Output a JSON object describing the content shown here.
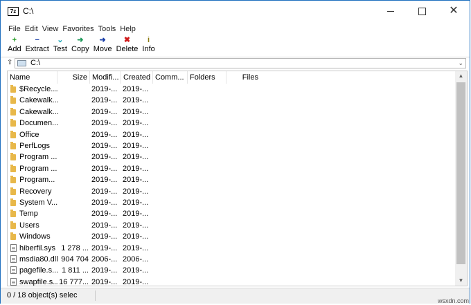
{
  "window": {
    "title": "C:\\",
    "icon": "7z-app-icon"
  },
  "menu": [
    "File",
    "Edit",
    "View",
    "Favorites",
    "Tools",
    "Help"
  ],
  "toolbar": [
    {
      "label": "Add",
      "icon": "+",
      "name": "add",
      "color": "#1e9a1e"
    },
    {
      "label": "Extract",
      "icon": "−",
      "name": "extract",
      "color": "#1a3fa8"
    },
    {
      "label": "Test",
      "icon": "⌄",
      "name": "test",
      "color": "#20a8b8"
    },
    {
      "label": "Copy",
      "icon": "➜",
      "name": "copy",
      "color": "#1e9a5a"
    },
    {
      "label": "Move",
      "icon": "➜",
      "name": "move",
      "color": "#1a3fa8"
    },
    {
      "label": "Delete",
      "icon": "✖",
      "name": "delete",
      "color": "#d01c1c"
    },
    {
      "label": "Info",
      "icon": "i",
      "name": "info",
      "color": "#8a7a10"
    }
  ],
  "address": {
    "path": "C:\\"
  },
  "columns": [
    "Name",
    "Size",
    "Modifi...",
    "Created",
    "Comm...",
    "Folders",
    "Files"
  ],
  "rows": [
    {
      "type": "folder",
      "name": "$Recycle....",
      "size": "",
      "modified": "2019-...",
      "created": "2019-..."
    },
    {
      "type": "folder",
      "name": "Cakewalk...",
      "size": "",
      "modified": "2019-...",
      "created": "2019-..."
    },
    {
      "type": "folder",
      "name": "Cakewalk...",
      "size": "",
      "modified": "2019-...",
      "created": "2019-..."
    },
    {
      "type": "folder",
      "name": "Documen...",
      "size": "",
      "modified": "2019-...",
      "created": "2019-..."
    },
    {
      "type": "folder",
      "name": "Office",
      "size": "",
      "modified": "2019-...",
      "created": "2019-..."
    },
    {
      "type": "folder",
      "name": "PerfLogs",
      "size": "",
      "modified": "2019-...",
      "created": "2019-..."
    },
    {
      "type": "folder",
      "name": "Program ...",
      "size": "",
      "modified": "2019-...",
      "created": "2019-..."
    },
    {
      "type": "folder",
      "name": "Program ...",
      "size": "",
      "modified": "2019-...",
      "created": "2019-..."
    },
    {
      "type": "folder",
      "name": "Program...",
      "size": "",
      "modified": "2019-...",
      "created": "2019-..."
    },
    {
      "type": "folder",
      "name": "Recovery",
      "size": "",
      "modified": "2019-...",
      "created": "2019-..."
    },
    {
      "type": "folder",
      "name": "System V...",
      "size": "",
      "modified": "2019-...",
      "created": "2019-..."
    },
    {
      "type": "folder",
      "name": "Temp",
      "size": "",
      "modified": "2019-...",
      "created": "2019-..."
    },
    {
      "type": "folder",
      "name": "Users",
      "size": "",
      "modified": "2019-...",
      "created": "2019-..."
    },
    {
      "type": "folder",
      "name": "Windows",
      "size": "",
      "modified": "2019-...",
      "created": "2019-..."
    },
    {
      "type": "file",
      "name": "hiberfil.sys",
      "size": "1 278 ...",
      "modified": "2019-...",
      "created": "2019-..."
    },
    {
      "type": "file",
      "name": "msdia80.dll",
      "size": "904 704",
      "modified": "2006-...",
      "created": "2006-..."
    },
    {
      "type": "file",
      "name": "pagefile.s...",
      "size": "1 811 ...",
      "modified": "2019-...",
      "created": "2019-..."
    },
    {
      "type": "file",
      "name": "swapfile.s...",
      "size": "16 777...",
      "modified": "2019-...",
      "created": "2019-..."
    }
  ],
  "status": {
    "text": "0 / 18 object(s) selec"
  },
  "watermark": "wsxdn.com"
}
